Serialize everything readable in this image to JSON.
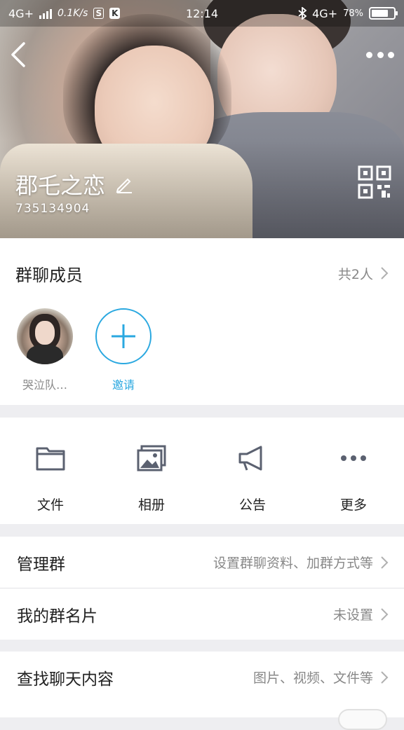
{
  "status_bar": {
    "network_left": "4G+",
    "speed": "0.1K/s",
    "badge_s": "S",
    "badge_k": "K",
    "time": "12:14",
    "network_right": "4G+",
    "battery_text": "78%",
    "battery_level": 0.78
  },
  "header": {
    "group_name": "郡乇之恋",
    "group_id": "735134904",
    "icons": [
      "back-icon",
      "more-icon",
      "edit-icon",
      "qr-code-icon"
    ]
  },
  "members": {
    "title": "群聊成员",
    "count_label": "共2人",
    "items": [
      {
        "name": "哭泣队…",
        "icon": "avatar"
      }
    ],
    "invite_label": "邀请"
  },
  "actions": [
    {
      "label": "文件",
      "icon": "folder-icon"
    },
    {
      "label": "相册",
      "icon": "album-icon"
    },
    {
      "label": "公告",
      "icon": "megaphone-icon"
    },
    {
      "label": "更多",
      "icon": "more-dots-icon"
    }
  ],
  "settings": {
    "manage": {
      "title": "管理群",
      "meta": "设置群聊资料、加群方式等"
    },
    "card": {
      "title": "我的群名片",
      "meta": "未设置"
    },
    "search": {
      "title": "查找聊天内容",
      "meta": "图片、视频、文件等"
    }
  },
  "colors": {
    "accent": "#2aa8e0",
    "icon_gray": "#5b6170",
    "meta_gray": "#888888"
  }
}
